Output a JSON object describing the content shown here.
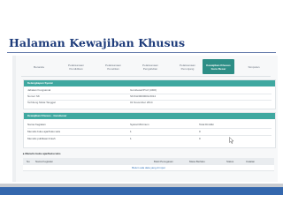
{
  "slide": {
    "title": "Halaman Kewajiban Khusus"
  },
  "tabs": [
    {
      "label": "Beranda"
    },
    {
      "label": "Pelaksanaan\nPendidikan"
    },
    {
      "label": "Pelaksanaan\nPenelitian"
    },
    {
      "label": "Pelaksanaan\nPengabdian"
    },
    {
      "label": "Pelaksanaan\nPenunjang"
    },
    {
      "label": "Kewajiban Khusus\nGuru Besar",
      "active": true
    },
    {
      "label": "Simpulan"
    }
  ],
  "info_panel": {
    "title": "Kelengkapan Syarat",
    "rows": [
      {
        "label": "Jabatan Fungsional",
        "value": "Gurubesar/Prof (1300)"
      },
      {
        "label": "Nomor SK",
        "value": "SK/KH/0000001/2014"
      },
      {
        "label": "Terhitung Mulai Tanggal",
        "value": "01 November 2014"
      }
    ]
  },
  "duty_panel": {
    "title": "Kewajiban Khusus - Gurubesar",
    "headers": {
      "kegiatan": "Nama Kegiatan",
      "minimum": "Syarat Minimum",
      "dimiliki": "Total Dimiliki"
    },
    "rows": [
      {
        "kegiatan": "Menulis buku ajar/buku teks",
        "minimum": "1",
        "dimiliki": "0"
      },
      {
        "kegiatan": "Menulis publikasi ilmiah",
        "minimum": "1",
        "dimiliki": "0"
      }
    ]
  },
  "sub_table": {
    "title": "Menulis buku ajar/buku teks",
    "headers": [
      "No",
      "Nama Kegiatan",
      "Bukti Penugasan",
      "Masa Berlaku",
      "Status",
      "Catatan"
    ],
    "empty_text": "Belum ada data yang di input"
  },
  "colors": {
    "title": "#1d3b7a",
    "teal": "#3fa8a0",
    "active_tab": "#2d8e86",
    "band": "#3467ad"
  }
}
